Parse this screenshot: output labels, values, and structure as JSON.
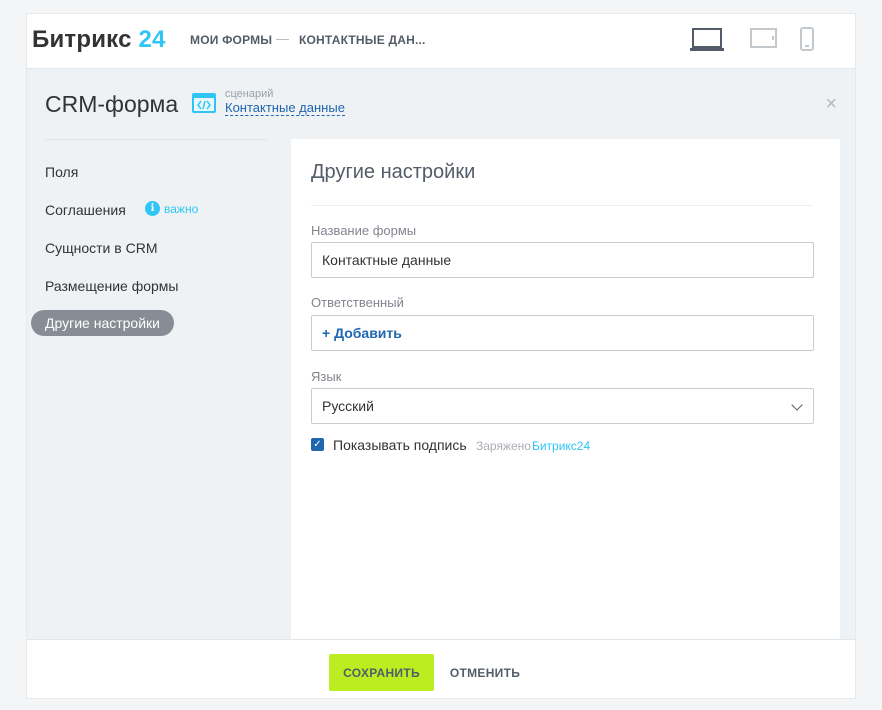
{
  "topbar": {
    "logo_text": "Битрикс",
    "logo_num": "24",
    "crumbs": [
      "МОИ ФОРМЫ",
      "КОНТАКТНЫЕ ДАН..."
    ],
    "separator": "—",
    "devices": [
      "laptop-icon",
      "tablet-icon",
      "phone-icon"
    ]
  },
  "header": {
    "title": "CRM-форма",
    "scenario_label": "сценарий",
    "scenario_name": "Контактные данные",
    "close": "×"
  },
  "sidebar": {
    "items": [
      {
        "label": "Поля"
      },
      {
        "label": "Соглашения",
        "badge": "важно"
      },
      {
        "label": "Сущности в CRM"
      },
      {
        "label": "Размещение формы"
      },
      {
        "label": "Другие настройки",
        "active": true
      }
    ]
  },
  "panel": {
    "title": "Другие настройки",
    "form_name_label": "Название формы",
    "form_name_value": "Контактные данные",
    "responsible_label": "Ответственный",
    "responsible_add": "+ Добавить",
    "language_label": "Язык",
    "language_value": "Русский",
    "show_signature_label": "Показывать подпись",
    "show_signature_checked": true,
    "powered_text": "Заряжено",
    "powered_brand": "Битрикс24"
  },
  "footer": {
    "save_label": "СОХРАНИТЬ",
    "cancel_label": "ОТМЕНИТЬ"
  },
  "colors": {
    "brand": "#2fc6f6",
    "save": "#bbed21",
    "link": "#2067b0",
    "active_item": "#868d95"
  }
}
